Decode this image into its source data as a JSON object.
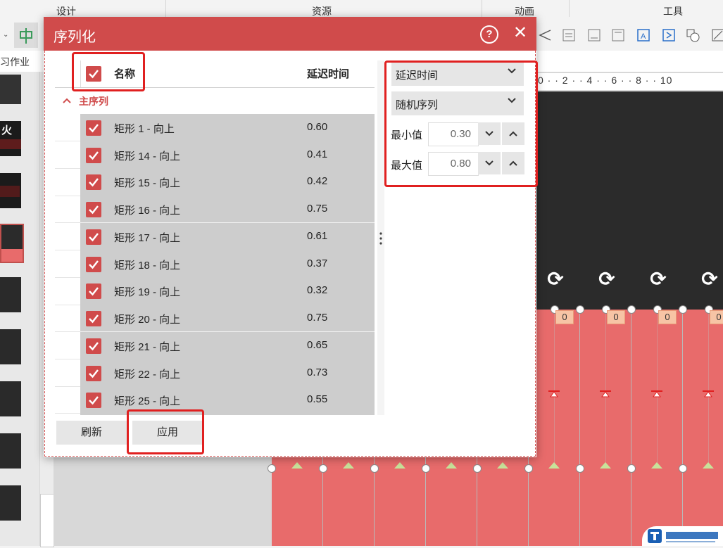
{
  "ribbon": {
    "groups": [
      "设计",
      "资源",
      "动画",
      "工具"
    ]
  },
  "tab": {
    "label": "习作业"
  },
  "slide_thumbs": {
    "thumb2_label": "火"
  },
  "ruler": {
    "text": "0 · · 2 · · 4 · · 6 · · 8 · · 10"
  },
  "canvas": {
    "order_tag": "0"
  },
  "dialog": {
    "title": "序列化",
    "help_label": "?",
    "close_label": "✕",
    "header_name": "名称",
    "header_delay": "延迟时间",
    "group_label": "主序列",
    "rows": [
      {
        "name": "矩形 1 - 向上",
        "value": "0.60"
      },
      {
        "name": "矩形 14 - 向上",
        "value": "0.41"
      },
      {
        "name": "矩形 15 - 向上",
        "value": "0.42"
      },
      {
        "name": "矩形 16 - 向上",
        "value": "0.75"
      },
      {
        "name": "矩形 17 - 向上",
        "value": "0.61"
      },
      {
        "name": "矩形 18 - 向上",
        "value": "0.37"
      },
      {
        "name": "矩形 19 - 向上",
        "value": "0.32"
      },
      {
        "name": "矩形 20 - 向上",
        "value": "0.75"
      },
      {
        "name": "矩形 21 - 向上",
        "value": "0.65"
      },
      {
        "name": "矩形 22 - 向上",
        "value": "0.73"
      },
      {
        "name": "矩形 25 - 向上",
        "value": "0.55"
      }
    ],
    "right": {
      "property_select": "延迟时间",
      "order_select": "随机序列",
      "min_label": "最小值",
      "min_value": "0.30",
      "max_label": "最大值",
      "max_value": "0.80"
    },
    "refresh_label": "刷新",
    "apply_label": "应用"
  },
  "colors": {
    "accent": "#d04b4b",
    "slide_red": "#e86b6b",
    "highlight": "#e02020"
  },
  "icons": [
    "help-icon",
    "close-icon",
    "checkbox-checked-icon",
    "chevron-up-icon",
    "chevron-down-icon",
    "rotate-icon"
  ]
}
